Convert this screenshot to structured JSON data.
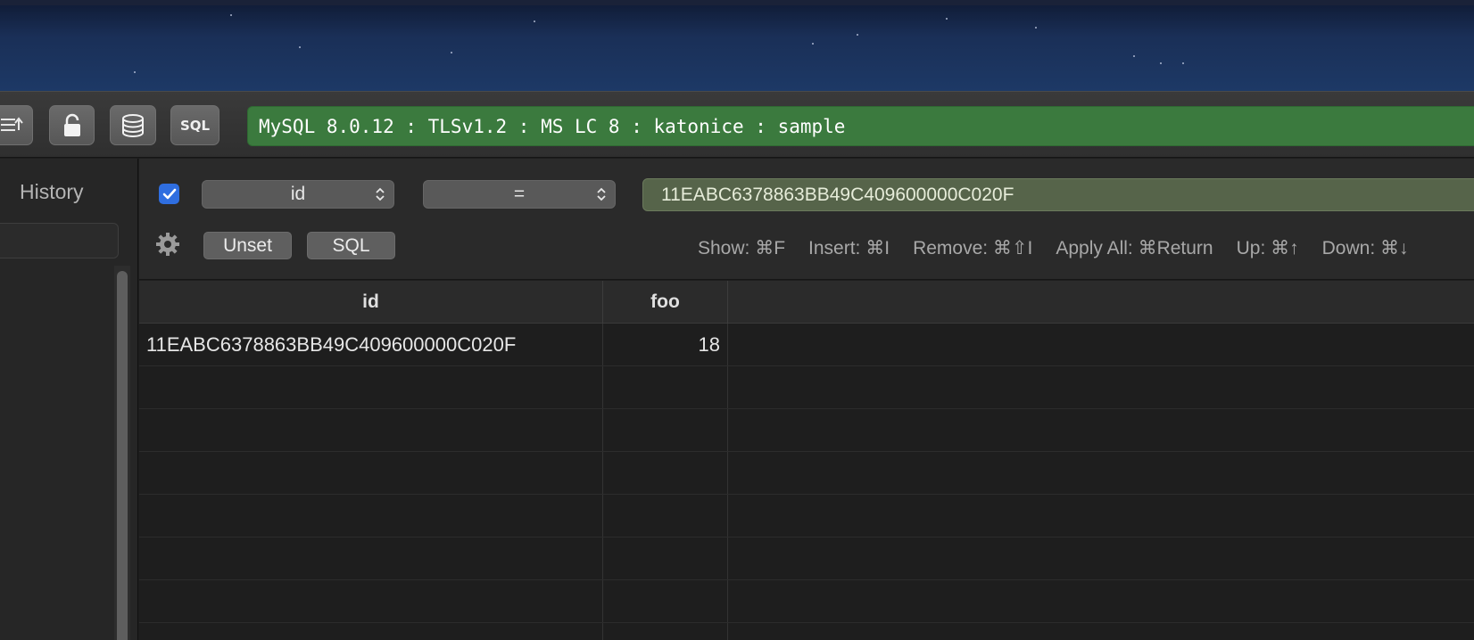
{
  "toolbar": {
    "sql_button_label": "SQL",
    "connection_status": "MySQL 8.0.12 : TLSv1.2 : MS LC 8 : katonice : sample"
  },
  "sidebar": {
    "tab_label": "History"
  },
  "filter": {
    "enabled": true,
    "column": "id",
    "operator": "=",
    "value": "11EABC6378863BB49C409600000C020F",
    "unset_label": "Unset",
    "sql_label": "SQL",
    "shortcuts": [
      "Show: ⌘F",
      "Insert: ⌘I",
      "Remove: ⌘⇧I",
      "Apply All: ⌘Return",
      "Up: ⌘↑",
      "Down: ⌘↓"
    ]
  },
  "table": {
    "columns": [
      "id",
      "foo"
    ],
    "rows": [
      [
        "11EABC6378863BB49C409600000C020F",
        "18"
      ],
      [
        "",
        ""
      ],
      [
        "",
        ""
      ],
      [
        "",
        ""
      ],
      [
        "",
        ""
      ],
      [
        "",
        ""
      ],
      [
        "",
        ""
      ],
      [
        "",
        ""
      ]
    ]
  },
  "colors": {
    "status_bar": "#3b7a3e",
    "filter_value_bg": "#56644a",
    "checkbox": "#2f6ee0"
  },
  "icons": [
    "filter-list-icon",
    "lock-icon",
    "database-icon",
    "gear-icon",
    "checkmark-icon",
    "chevron-updown-icon"
  ]
}
